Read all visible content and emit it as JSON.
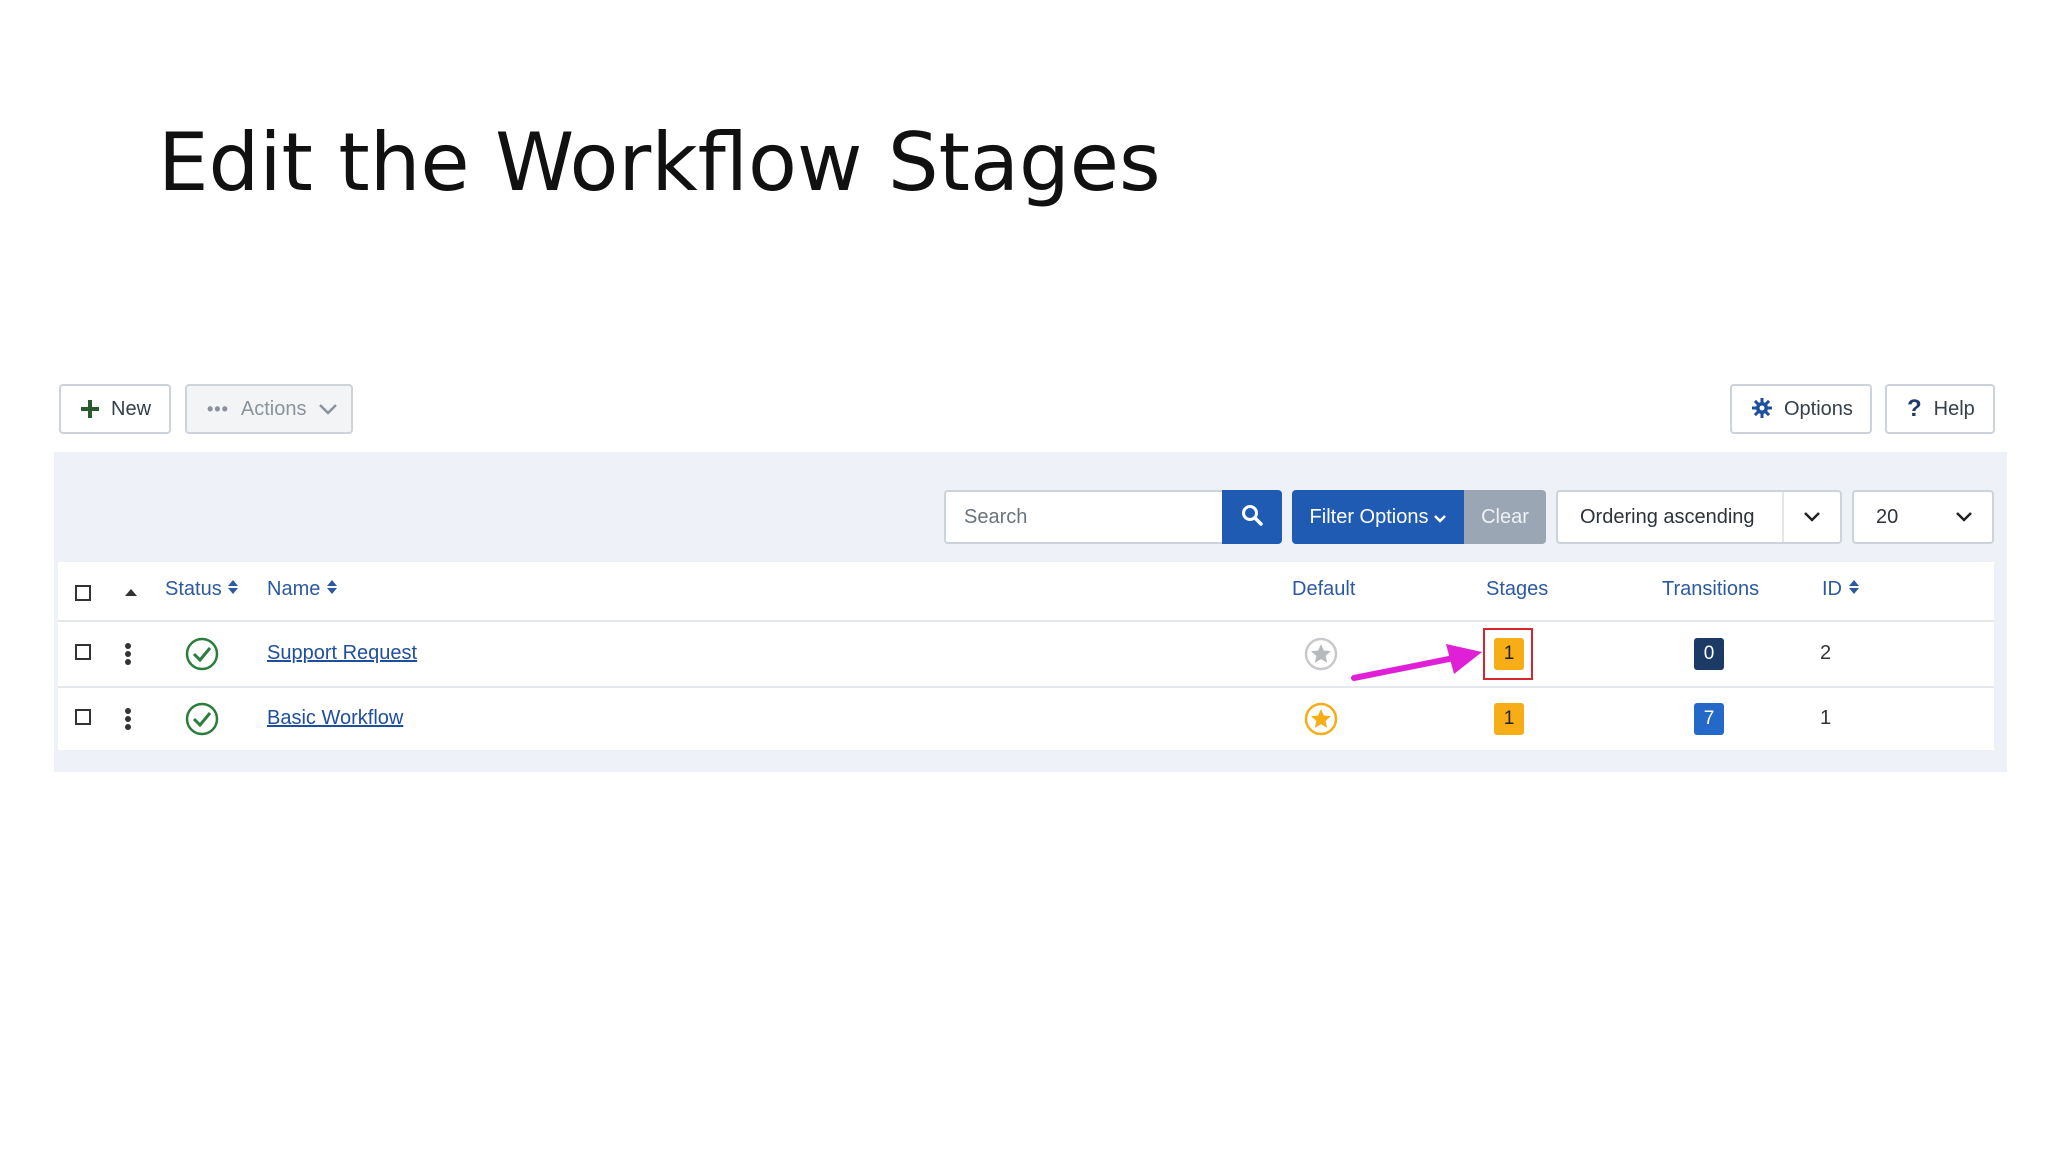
{
  "slide": {
    "title": "Edit the Workflow Stages"
  },
  "toolbar": {
    "new_label": "New",
    "actions_label": "Actions",
    "options_label": "Options",
    "help_label": "Help",
    "help_glyph": "?"
  },
  "filters": {
    "search_placeholder": "Search",
    "filter_options_label": "Filter Options",
    "clear_label": "Clear",
    "ordering_value": "Ordering ascending",
    "limit_value": "20"
  },
  "table": {
    "headers": {
      "status": "Status",
      "name": "Name",
      "default": "Default",
      "stages": "Stages",
      "transitions": "Transitions",
      "id": "ID"
    },
    "rows": [
      {
        "name": "Support Request",
        "status": "published",
        "default": false,
        "stages": "1",
        "transitions": "0",
        "id": "2"
      },
      {
        "name": "Basic Workflow",
        "status": "published",
        "default": true,
        "stages": "1",
        "transitions": "7",
        "id": "1"
      }
    ]
  },
  "colors": {
    "primary_blue": "#1f5bb3",
    "stage_badge": "#f6ad16",
    "transitions_zero": "#1b3a66",
    "transitions_nonzero": "#2469c8",
    "status_green": "#2a7d3a",
    "annotation_arrow": "#e020d6",
    "annotation_box": "#d7262e"
  },
  "icons": [
    "plus-icon",
    "ellipsis-icon",
    "chevron-down-icon",
    "gear-icon",
    "question-icon",
    "search-icon",
    "sort-icon",
    "caret-up-icon",
    "kebab-icon",
    "check-circle-icon",
    "star-icon",
    "arrow-icon"
  ]
}
